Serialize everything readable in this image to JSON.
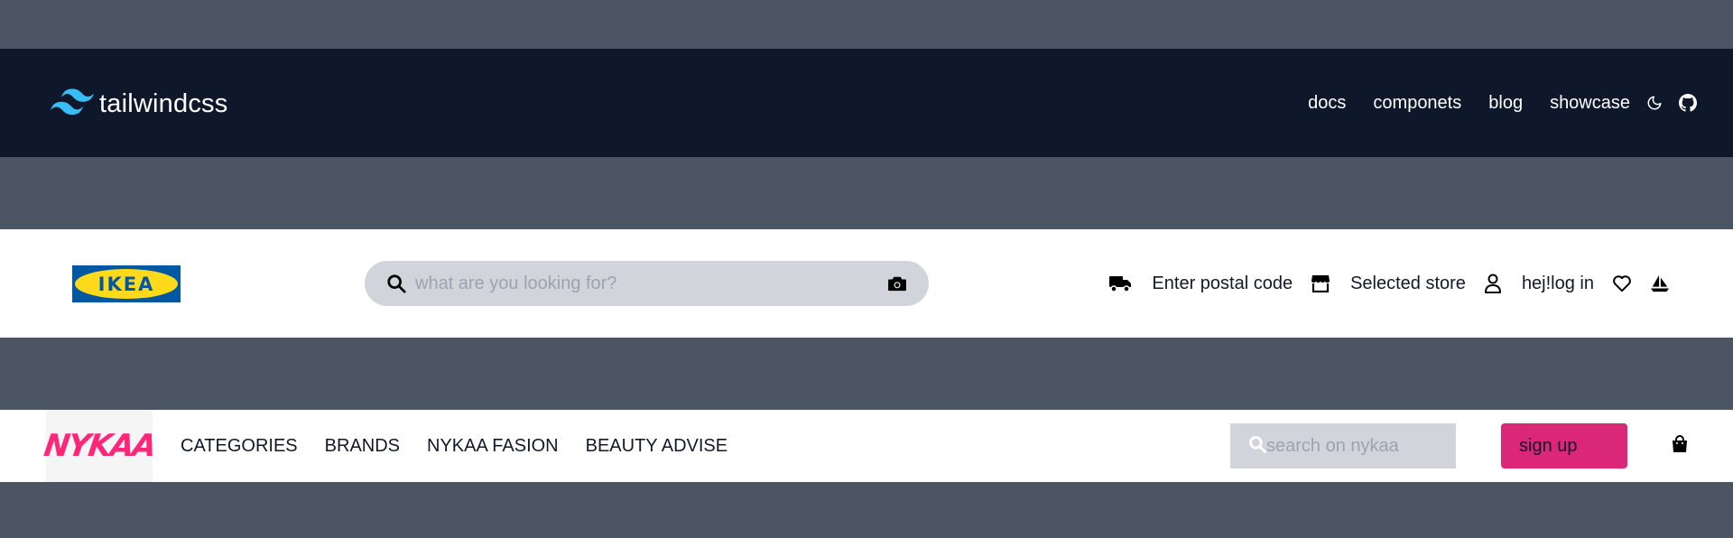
{
  "tailwind_nav": {
    "brand": "tailwindcss",
    "links": [
      "docs",
      "componets",
      "blog",
      "showcase"
    ],
    "icons": [
      "moon-icon",
      "github-icon"
    ],
    "colors": {
      "background": "#0f172a",
      "logo": "#38bdf8"
    }
  },
  "ikea_nav": {
    "logo_text": "IKEA",
    "search_placeholder": "what are you looking for?",
    "actions": [
      {
        "icon": "truck-icon",
        "label": "Enter postal code"
      },
      {
        "icon": "store-icon",
        "label": "Selected store"
      },
      {
        "icon": "user-icon",
        "label": "hej!log in"
      }
    ],
    "trailing_icons": [
      "heart-icon",
      "sailboat-icon"
    ],
    "colors": {
      "logo_blue": "#0058a3",
      "logo_yellow": "#ffda1a",
      "search_bg": "#d1d5db"
    }
  },
  "nykaa_nav": {
    "logo_text": "NYKAA",
    "menu": [
      "CATEGORIES",
      "BRANDS",
      "NYKAA FASION",
      "BEAUTY ADVISE"
    ],
    "search_placeholder": "search on nykaa",
    "signup_label": "sign up",
    "icons": [
      "search-icon",
      "shopping-bag-icon"
    ],
    "colors": {
      "brand": "#fc2779",
      "button": "#db2777"
    }
  },
  "page": {
    "background": "#4b5563"
  }
}
